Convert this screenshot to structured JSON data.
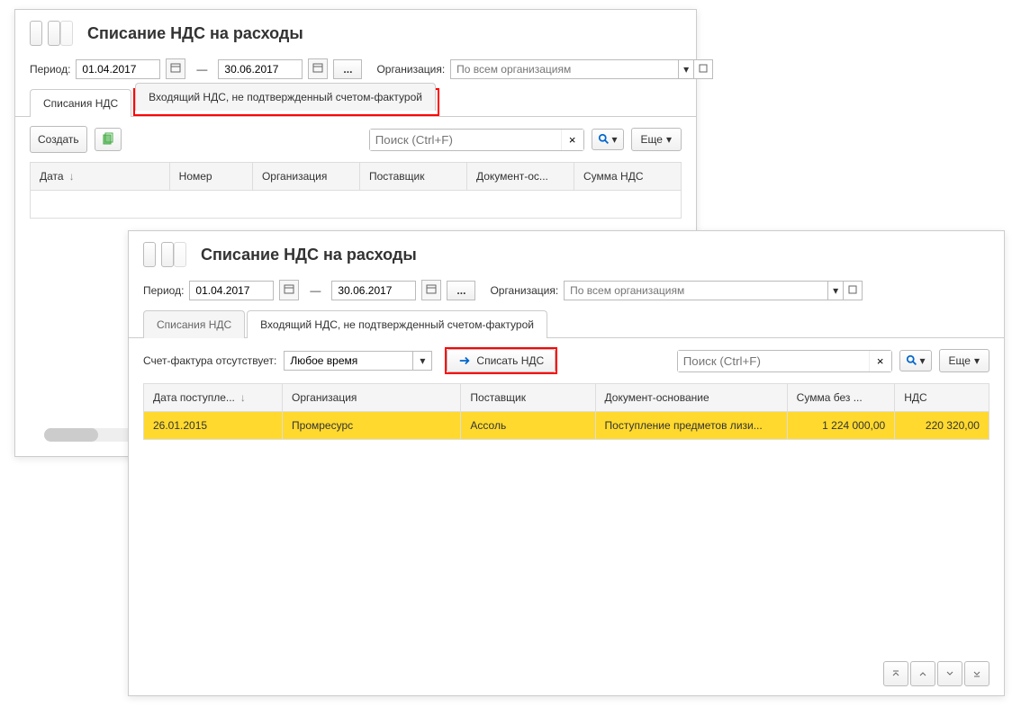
{
  "win1": {
    "title": "Списание НДС на расходы",
    "period_label": "Период:",
    "period_from": "01.04.2017",
    "period_to": "30.06.2017",
    "org_label": "Организация:",
    "org_placeholder": "По всем организациям",
    "tabs": [
      "Списания НДС",
      "Входящий НДС, не подтвержденный счетом-фактурой"
    ],
    "create_btn": "Создать",
    "search_placeholder": "Поиск (Ctrl+F)",
    "more_btn": "Еще",
    "cols": [
      "Дата",
      "Номер",
      "Организация",
      "Поставщик",
      "Документ-ос...",
      "Сумма НДС"
    ]
  },
  "win2": {
    "title": "Списание НДС на расходы",
    "period_label": "Период:",
    "period_from": "01.04.2017",
    "period_to": "30.06.2017",
    "org_label": "Организация:",
    "org_placeholder": "По всем организациям",
    "tabs": [
      "Списания НДС",
      "Входящий НДС, не подтвержденный счетом-фактурой"
    ],
    "sf_label": "Счет-фактура отсутствует:",
    "sf_value": "Любое время",
    "writeoff_btn": "Списать НДС",
    "search_placeholder": "Поиск (Ctrl+F)",
    "more_btn": "Еще",
    "cols": [
      "Дата поступле...",
      "Организация",
      "Поставщик",
      "Документ-основание",
      "Сумма без ...",
      "НДС"
    ],
    "row": {
      "date": "26.01.2015",
      "org": "Промресурс",
      "supplier": "Ассоль",
      "doc": "Поступление предметов лизи...",
      "sum": "1 224 000,00",
      "vat": "220 320,00"
    }
  }
}
